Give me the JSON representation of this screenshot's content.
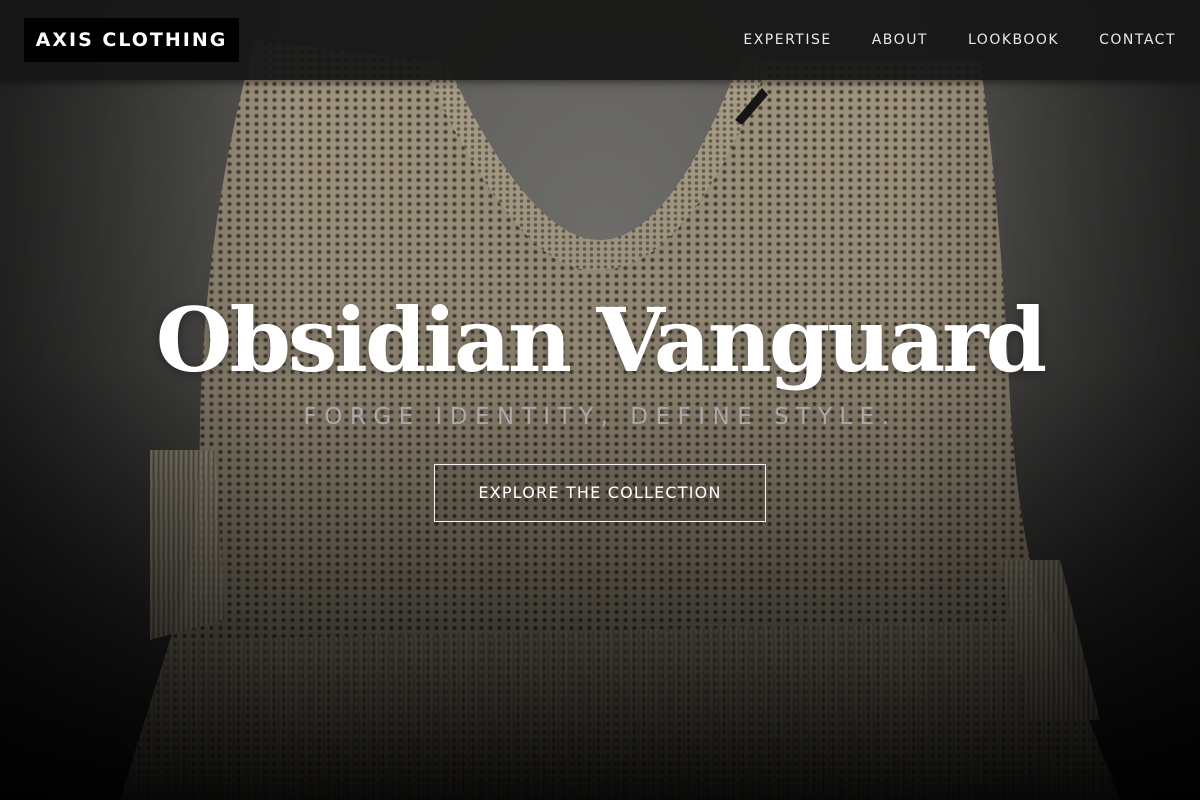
{
  "header": {
    "logo_text": "AXIS CLOTHING",
    "nav": [
      {
        "label": "EXPERTISE"
      },
      {
        "label": "ABOUT"
      },
      {
        "label": "LOOKBOOK"
      },
      {
        "label": "CONTACT"
      }
    ]
  },
  "hero": {
    "title": "Obsidian Vanguard",
    "subtitle": "FORGE IDENTITY, DEFINE STYLE.",
    "cta_label": "EXPLORE THE COLLECTION",
    "background": "knit-sweater-photo"
  },
  "colors": {
    "header_bg": "#161616",
    "logo_bg": "#000000",
    "text": "#ffffff",
    "subtitle": "#a9a9ab",
    "sweater": "#cdbfa4"
  }
}
